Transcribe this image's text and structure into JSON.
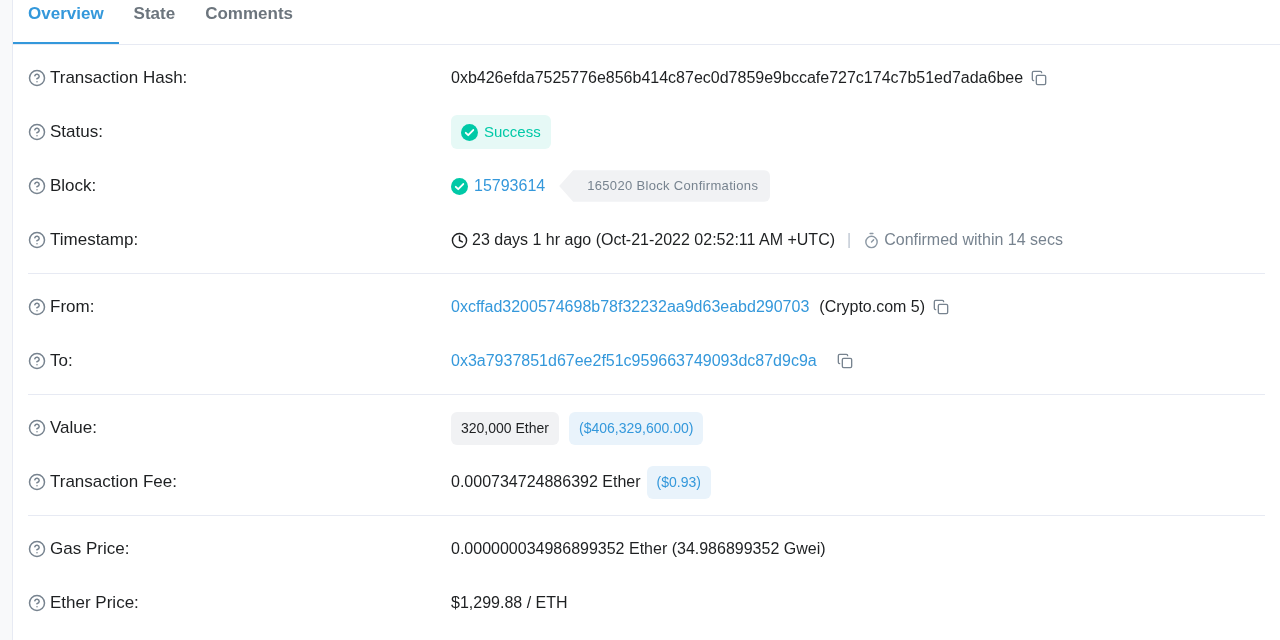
{
  "tabs": [
    {
      "label": "Overview",
      "selected": true
    },
    {
      "label": "State",
      "selected": false
    },
    {
      "label": "Comments",
      "selected": false
    }
  ],
  "sections": [
    {
      "rows": [
        {
          "kind": "hash",
          "label": "Transaction Hash:",
          "value": "0xb426efda7525776e856b414c87ec0d7859e9bccafe727c174c7b51ed7ada6bee"
        },
        {
          "kind": "status",
          "label": "Status:",
          "value": "Success"
        },
        {
          "kind": "block",
          "label": "Block:",
          "value": "15793614",
          "confirmations": "165020 Block Confirmations"
        },
        {
          "kind": "timestamp",
          "label": "Timestamp:",
          "value": "23 days 1 hr ago (Oct-21-2022 02:52:11 AM +UTC)",
          "separator": "|",
          "confirmed": "Confirmed within 14 secs"
        }
      ]
    },
    {
      "rows": [
        {
          "kind": "address",
          "label": "From:",
          "value": "0xcffad3200574698b78f32232aa9d63eabd290703",
          "note": "(Crypto.com 5)"
        },
        {
          "kind": "address",
          "label": "To:",
          "value": "0x3a7937851d67ee2f51c959663749093dc87d9c9a"
        }
      ]
    },
    {
      "rows": [
        {
          "kind": "value",
          "label": "Value:",
          "value": "320,000 Ether",
          "usd": "($406,329,600.00)"
        },
        {
          "kind": "fee",
          "label": "Transaction Fee:",
          "value": "0.000734724886392 Ether",
          "usd": "($0.93)"
        }
      ]
    },
    {
      "rows": [
        {
          "kind": "text",
          "label": "Gas Price:",
          "value": "0.000000034986899352 Ether (34.986899352 Gwei)"
        },
        {
          "kind": "text",
          "label": "Ether Price:",
          "value": "$1,299.88 / ETH"
        }
      ]
    }
  ]
}
